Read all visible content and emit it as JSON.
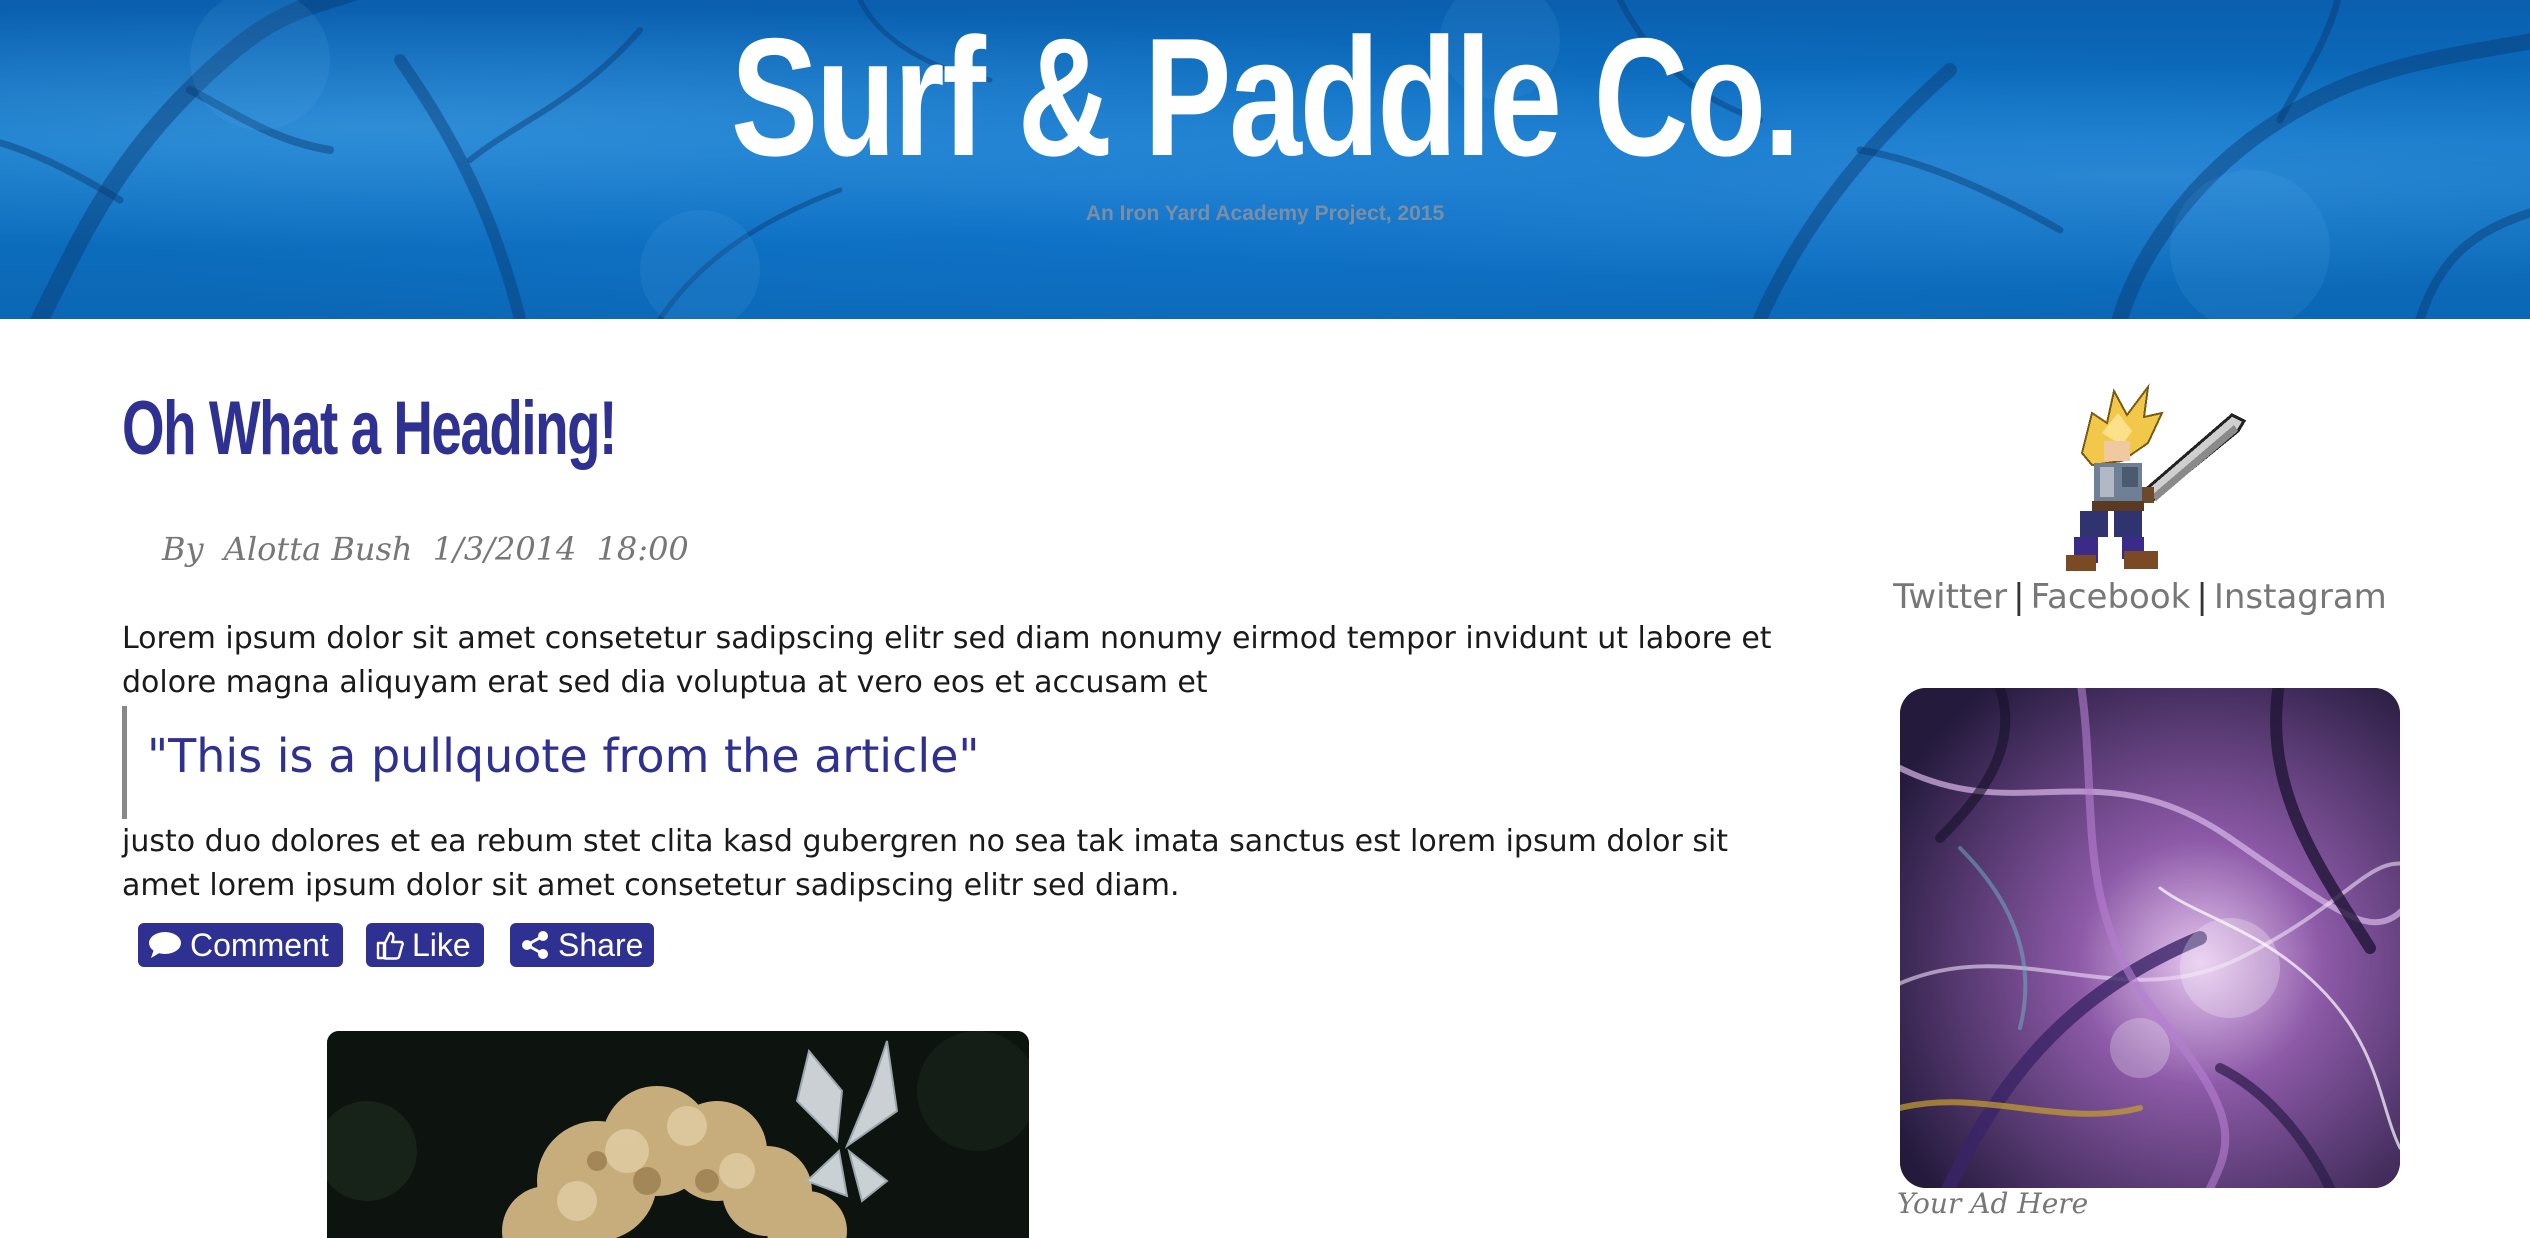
{
  "header": {
    "title": "Surf & Paddle Co.",
    "subtitle": "An Iron Yard Academy Project, 2015"
  },
  "article": {
    "heading": "Oh What a Heading!",
    "byline": {
      "prefix": "By",
      "author": "Alotta Bush",
      "date": "1/3/2014",
      "time": "18:00"
    },
    "paragraph1": "Lorem ipsum dolor sit amet consetetur sadipscing elitr sed diam nonumy eirmod tempor invidunt ut labore et dolore magna aliquyam erat sed dia voluptua at vero eos et accusam et",
    "pullquote": "\"This is a pullquote from the article\"",
    "paragraph2": "justo duo dolores et ea rebum stet clita kasd gubergren no sea tak imata sanctus est lorem ipsum dolor sit amet lorem ipsum dolor sit amet consetetur sadipscing elitr sed diam.",
    "actions": {
      "comment": {
        "label": "Comment",
        "icon": "comment-icon"
      },
      "like": {
        "label": "Like",
        "icon": "thumbs-up-icon"
      },
      "share": {
        "label": "Share",
        "icon": "share-icon"
      }
    }
  },
  "sidebar": {
    "social": {
      "twitter": "Twitter",
      "separator": "|",
      "facebook": "Facebook",
      "instagram": "Instagram"
    },
    "ad_caption": "Your Ad Here"
  },
  "colors": {
    "brand": "#2e3192",
    "header_blue": "#0d74c6",
    "muted_text": "#777777"
  }
}
